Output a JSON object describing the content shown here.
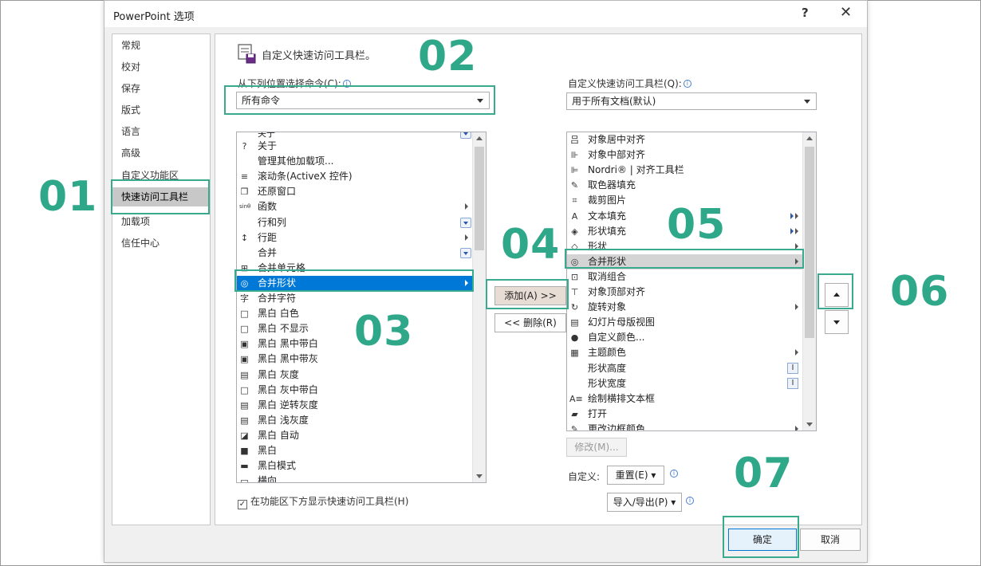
{
  "window": {
    "title": "PowerPoint 选项",
    "help": "?",
    "close": "✕"
  },
  "nav": [
    {
      "label": "常规"
    },
    {
      "label": "校对"
    },
    {
      "label": "保存"
    },
    {
      "label": "版式"
    },
    {
      "label": "语言"
    },
    {
      "label": "高级"
    },
    {
      "label": "自定义功能区"
    },
    {
      "label": "快速访问工具栏"
    },
    {
      "label": "加载项"
    },
    {
      "label": "信任中心"
    }
  ],
  "header": {
    "title": "自定义快速访问工具栏。"
  },
  "left": {
    "label": "从下列位置选择命令(C):",
    "dropdown": "所有命令",
    "items": [
      {
        "label": "关于",
        "icon": "?",
        "icon_name": "help-circle-icon"
      },
      {
        "label": "管理其他加载项...",
        "icon": "",
        "icon_name": "none-icon"
      },
      {
        "label": "滚动条(ActiveX 控件)",
        "icon": "≡",
        "icon_name": "scrollbar-icon"
      },
      {
        "label": "还原窗口",
        "icon": "❐",
        "icon_name": "restore-window-icon"
      },
      {
        "label": "函数",
        "icon": "sinθ",
        "icon_name": "function-icon",
        "sub": true
      },
      {
        "label": "行和列",
        "icon": "",
        "icon_name": "none-icon",
        "dd": true
      },
      {
        "label": "行距",
        "icon": "↕",
        "icon_name": "line-spacing-icon",
        "sub": true
      },
      {
        "label": "合并",
        "icon": "",
        "icon_name": "none-icon",
        "dd": true
      },
      {
        "label": "合并单元格",
        "icon": "⊞",
        "icon_name": "merge-cells-icon"
      },
      {
        "label": "合并形状",
        "icon": "◎",
        "icon_name": "merge-shapes-icon",
        "sub": true,
        "selected": true
      },
      {
        "label": "合并字符",
        "icon": "字",
        "icon_name": "combine-characters-icon"
      },
      {
        "label": "黑白 白色",
        "icon": "□",
        "icon_name": "bw-white-icon"
      },
      {
        "label": "黑白 不显示",
        "icon": "□",
        "icon_name": "bw-hide-icon"
      },
      {
        "label": "黑白 黑中带白",
        "icon": "▣",
        "icon_name": "bw-black-white-icon"
      },
      {
        "label": "黑白 黑中带灰",
        "icon": "▣",
        "icon_name": "bw-black-gray-icon"
      },
      {
        "label": "黑白 灰度",
        "icon": "▤",
        "icon_name": "bw-grayscale-icon"
      },
      {
        "label": "黑白 灰中带白",
        "icon": "□",
        "icon_name": "bw-gray-white-icon"
      },
      {
        "label": "黑白 逆转灰度",
        "icon": "▤",
        "icon_name": "bw-inverse-gray-icon"
      },
      {
        "label": "黑白 浅灰度",
        "icon": "▤",
        "icon_name": "bw-light-gray-icon"
      },
      {
        "label": "黑白 自动",
        "icon": "◪",
        "icon_name": "bw-auto-icon"
      },
      {
        "label": "黑白",
        "icon": "■",
        "icon_name": "bw-black-icon"
      },
      {
        "label": "黑白模式",
        "icon": "▬",
        "icon_name": "bw-mode-icon"
      },
      {
        "label": "横向",
        "icon": "▭",
        "icon_name": "landscape-icon"
      }
    ],
    "partial_top": "关于",
    "checkbox": "在功能区下方显示快速访问工具栏(H)"
  },
  "middle": {
    "add": "添加(A) >>",
    "remove": "<< 删除(R)"
  },
  "right": {
    "label": "自定义快速访问工具栏(Q):",
    "dropdown": "用于所有文档(默认)",
    "items": [
      {
        "label": "对象居中对齐",
        "icon": "吕",
        "icon_name": "align-center-icon"
      },
      {
        "label": "对象中部对齐",
        "icon": "⊪",
        "icon_name": "align-middle-icon"
      },
      {
        "label": "Nordri® | 对齐工具栏",
        "icon": "⊫",
        "icon_name": "nordri-align-icon"
      },
      {
        "label": "取色器填充",
        "icon": "✎",
        "icon_name": "eyedropper-icon"
      },
      {
        "label": "裁剪图片",
        "icon": "⌗",
        "icon_name": "crop-icon"
      },
      {
        "label": "文本填充",
        "icon": "A",
        "icon_name": "text-fill-icon",
        "ib": true,
        "sub": true
      },
      {
        "label": "形状填充",
        "icon": "◈",
        "icon_name": "shape-fill-icon",
        "ib": true,
        "sub": true
      },
      {
        "label": "形状",
        "icon": "◇",
        "icon_name": "shapes-icon",
        "sub": true
      },
      {
        "label": "合并形状",
        "icon": "◎",
        "icon_name": "merge-shapes-icon",
        "sub": true,
        "selected": true
      },
      {
        "label": "取消组合",
        "icon": "⊡",
        "icon_name": "ungroup-icon"
      },
      {
        "label": "对象顶部对齐",
        "icon": "⊤",
        "icon_name": "align-top-icon"
      },
      {
        "label": "旋转对象",
        "icon": "↻",
        "icon_name": "rotate-icon",
        "sub": true
      },
      {
        "label": "幻灯片母版视图",
        "icon": "▤",
        "icon_name": "slide-master-icon"
      },
      {
        "label": "自定义颜色...",
        "icon": "●",
        "icon_name": "custom-color-icon"
      },
      {
        "label": "主题颜色",
        "icon": "▦",
        "icon_name": "theme-colors-icon",
        "sub": true
      },
      {
        "label": "形状高度",
        "icon": "",
        "icon_name": "none-icon",
        "cursor": true
      },
      {
        "label": "形状宽度",
        "icon": "",
        "icon_name": "none-icon",
        "cursor": true
      },
      {
        "label": "绘制横排文本框",
        "icon": "A≡",
        "icon_name": "textbox-icon"
      },
      {
        "label": "打开",
        "icon": "▰",
        "icon_name": "open-folder-icon"
      },
      {
        "label": "更改边框颜色",
        "icon": "✎",
        "icon_name": "border-color-icon",
        "sub": true
      }
    ],
    "modify": "修改(M)...",
    "customize_label": "自定义:",
    "reset": "重置(E) ▾",
    "import_export": "导入/导出(P) ▾"
  },
  "footer": {
    "ok": "确定",
    "cancel": "取消"
  },
  "annotations": [
    "01",
    "02",
    "03",
    "04",
    "05",
    "06",
    "07"
  ],
  "colors": {
    "accent": "#2fa88a",
    "selected_blue": "#0078d7",
    "selected_gray": "#d4d4d4"
  }
}
